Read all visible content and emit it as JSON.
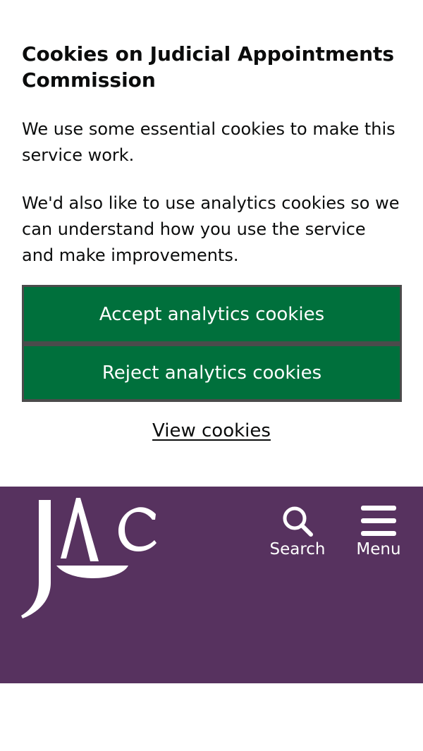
{
  "cookie_banner": {
    "title": "Cookies on Judicial Appointments Commission",
    "paragraph_1": "We use some essential cookies to make this service work.",
    "paragraph_2": "We'd also like to use analytics cookies so we can understand how you use the service and make improvements.",
    "accept_label": "Accept analytics cookies",
    "reject_label": "Reject analytics cookies",
    "view_cookies_label": "View cookies"
  },
  "header": {
    "logo_text": "JAC",
    "logo_icon": "jac-logo",
    "search_label": "Search",
    "search_icon": "search-icon",
    "menu_label": "Menu",
    "menu_icon": "hamburger-menu-icon"
  },
  "colors": {
    "button_green": "#00703c",
    "header_purple": "#57325f",
    "text_dark": "#0b0c0c"
  }
}
